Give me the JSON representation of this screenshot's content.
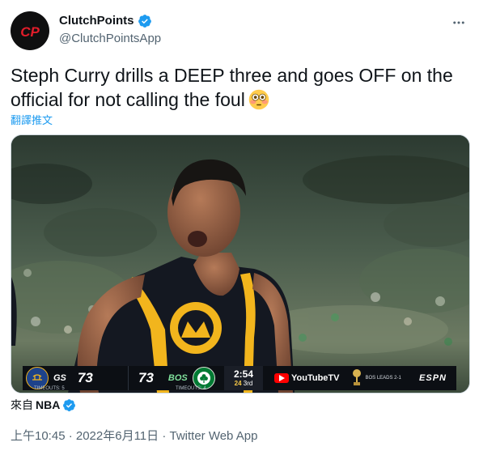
{
  "author": {
    "display_name": "ClutchPoints",
    "handle": "@ClutchPointsApp",
    "avatar_text": "CP"
  },
  "tweet": {
    "text": "Steph Curry drills a DEEP three and goes OFF on the official for not calling the foul",
    "emoji": "flushed-face",
    "translate_label": "翻譯推文"
  },
  "scoreboard": {
    "away_abbr": "GS",
    "away_score": "73",
    "away_timeouts": "TIMEOUTS: 5",
    "home_score": "73",
    "home_abbr": "BOS",
    "home_timeouts": "TIMEOUTS: 4",
    "game_clock": "2:54",
    "shot_clock": "24",
    "quarter": "3rd",
    "sponsor": "YouTubeTV",
    "series_status": "BOS LEADS 2-1",
    "network": "ESPN",
    "colors": {
      "gs": "#1d428a",
      "bos": "#007a33",
      "bar": "#0c0f14"
    }
  },
  "source": {
    "prefix": "來自",
    "name": "NBA"
  },
  "meta": {
    "timestamp": "上午10:45 · 2022年6月11日 · Twitter Web App"
  },
  "colors": {
    "accent": "#1d9bf0",
    "muted": "#536471",
    "text": "#0f1419"
  }
}
